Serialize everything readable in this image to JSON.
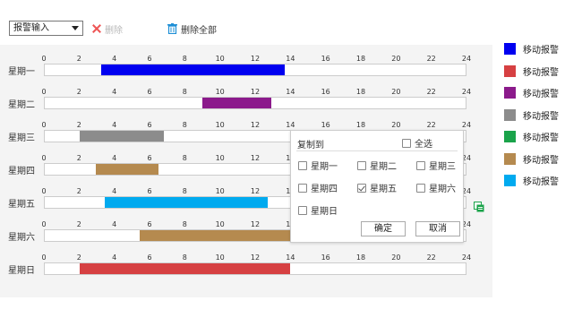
{
  "toolbar": {
    "alarm_select": "报警输入",
    "delete_label": "删除",
    "delete_all_label": "删除全部"
  },
  "schedule": {
    "axis_ticks": [
      "0",
      "2",
      "4",
      "6",
      "8",
      "10",
      "12",
      "14",
      "16",
      "18",
      "20",
      "22",
      "24"
    ],
    "days": [
      {
        "label": "星期一",
        "segments": [
          {
            "start": 3.2,
            "end": 13.7,
            "color": "#0000f0"
          }
        ]
      },
      {
        "label": "星期二",
        "segments": [
          {
            "start": 9.0,
            "end": 12.9,
            "color": "#8b1a8b"
          }
        ]
      },
      {
        "label": "星期三",
        "segments": [
          {
            "start": 2.0,
            "end": 6.8,
            "color": "#8c8c8c"
          }
        ]
      },
      {
        "label": "星期四",
        "segments": [
          {
            "start": 2.9,
            "end": 6.5,
            "color": "#b58a4f"
          }
        ]
      },
      {
        "label": "星期五",
        "segments": [
          {
            "start": 3.4,
            "end": 12.7,
            "color": "#00aaef"
          }
        ]
      },
      {
        "label": "星期六",
        "segments": [
          {
            "start": 5.4,
            "end": 17.9,
            "color": "#b58a4f"
          }
        ]
      },
      {
        "label": "星期日",
        "segments": [
          {
            "start": 2.0,
            "end": 14.0,
            "color": "#d64042"
          }
        ]
      }
    ]
  },
  "copy_popup": {
    "title": "复制到",
    "select_all": "全选",
    "days": [
      "星期一",
      "星期二",
      "星期三",
      "星期四",
      "星期五",
      "星期六",
      "星期日"
    ],
    "checked": [
      false,
      false,
      false,
      false,
      true,
      false,
      false
    ],
    "ok_label": "确定",
    "cancel_label": "取消"
  },
  "legend": [
    {
      "label": "移动报警",
      "color": "#0000f0"
    },
    {
      "label": "移动报警",
      "color": "#d64042"
    },
    {
      "label": "移动报警",
      "color": "#8b1a8b"
    },
    {
      "label": "移动报警",
      "color": "#8c8c8c"
    },
    {
      "label": "移动报警",
      "color": "#1aa34a"
    },
    {
      "label": "移动报警",
      "color": "#b58a4f"
    },
    {
      "label": "移动报警",
      "color": "#00aaef"
    }
  ]
}
